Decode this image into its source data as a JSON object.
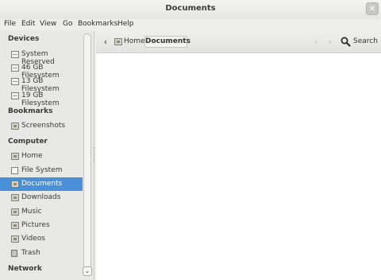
{
  "window": {
    "title": "Documents",
    "close_glyph": "✕"
  },
  "menubar": {
    "items": [
      "File",
      "Edit",
      "View",
      "Go",
      "Bookmarks",
      "Help"
    ]
  },
  "sidebar": {
    "sections": {
      "devices": "Devices",
      "bookmarks": "Bookmarks",
      "computer": "Computer",
      "network": "Network"
    },
    "devices": [
      {
        "label": "System Reserved",
        "icon": "drive-icon"
      },
      {
        "label": "46 GB Filesystem",
        "icon": "drive-icon"
      },
      {
        "label": "13 GB Filesystem",
        "icon": "drive-icon"
      },
      {
        "label": "19 GB Filesystem",
        "icon": "drive-icon"
      }
    ],
    "bookmarks": [
      {
        "label": "Screenshots",
        "icon": "folder-icon"
      }
    ],
    "computer": [
      {
        "label": "Home",
        "icon": "home-folder-icon"
      },
      {
        "label": "File System",
        "icon": "filesystem-icon"
      },
      {
        "label": "Documents",
        "icon": "folder-icon",
        "selected": true
      },
      {
        "label": "Downloads",
        "icon": "folder-icon"
      },
      {
        "label": "Music",
        "icon": "folder-icon"
      },
      {
        "label": "Pictures",
        "icon": "folder-icon"
      },
      {
        "label": "Videos",
        "icon": "folder-icon"
      },
      {
        "label": "Trash",
        "icon": "trash-icon"
      }
    ]
  },
  "toolbar": {
    "back_glyph": "‹",
    "breadcrumb_home": "Home",
    "breadcrumb_current": "Documents",
    "prev_glyph": "‹",
    "next_glyph": "›",
    "search_label": "Search",
    "scroll_down_glyph": "⌄"
  },
  "colors": {
    "selection": "#4a90d9",
    "content_background": "#ffffff",
    "window_background": "#ededec"
  }
}
